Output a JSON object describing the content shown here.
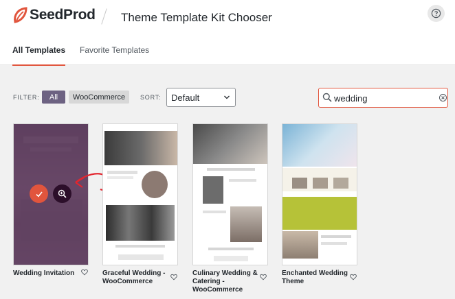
{
  "header": {
    "logo_text": "SeedProd",
    "title": "Theme Template Kit Chooser",
    "help_icon": "question-circle-icon"
  },
  "tabs": [
    {
      "label": "All Templates",
      "active": true
    },
    {
      "label": "Favorite Templates",
      "active": false
    }
  ],
  "filter": {
    "label": "FILTER:",
    "options": [
      {
        "label": "All",
        "active": true
      },
      {
        "label": "WooCommerce",
        "active": false
      }
    ]
  },
  "sort": {
    "label": "SORT:",
    "value": "Default"
  },
  "search": {
    "value": "wedding"
  },
  "templates": [
    {
      "name": "Wedding Invitation",
      "hovered": true
    },
    {
      "name": "Graceful Wedding - WooCommerce",
      "hovered": false
    },
    {
      "name": "Culinary Wedding & Catering - WooCommerce",
      "hovered": false
    },
    {
      "name": "Enchanted Wedding Theme",
      "hovered": false
    }
  ],
  "colors": {
    "accent": "#e1553d",
    "filter_active": "#6d6282",
    "overlay": "#5a3c5f",
    "preview_button": "#2c0f2a"
  }
}
